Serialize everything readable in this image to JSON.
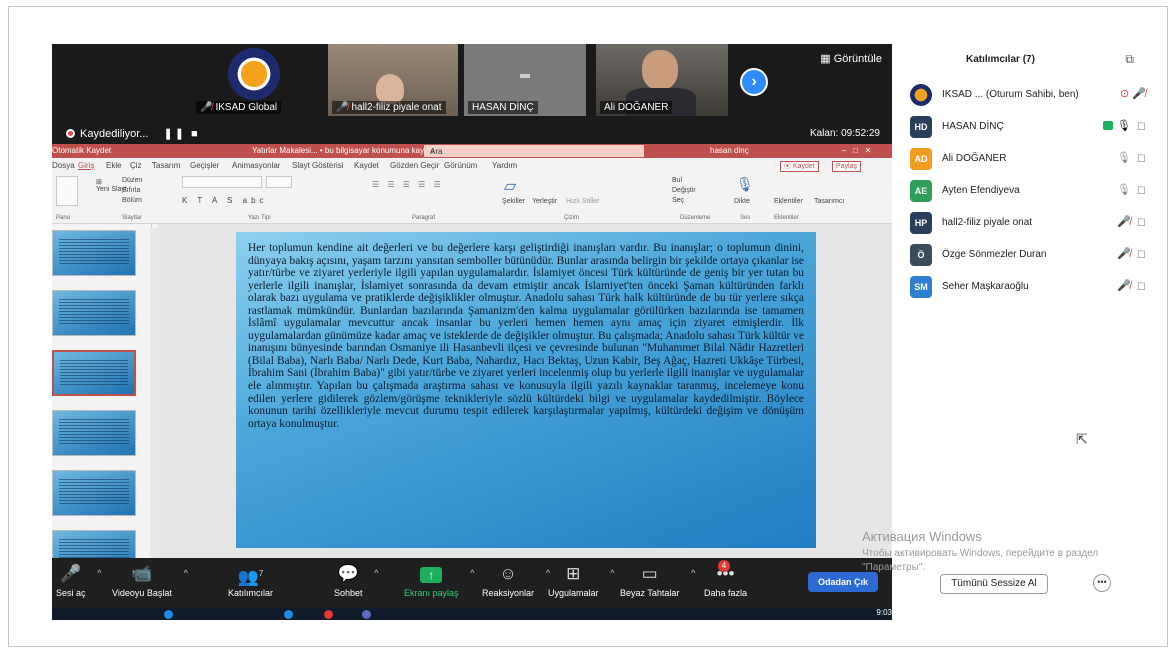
{
  "top_strip": {
    "tiles": [
      {
        "name": "IKSAD Global",
        "muted": true
      },
      {
        "name": "hall2-filiz piyale onat",
        "muted": true
      },
      {
        "name": "HASAN DİNÇ",
        "muted": false
      },
      {
        "name": "Ali DOĞANER",
        "muted": false
      }
    ],
    "view_label": "Görüntüle"
  },
  "recording": {
    "label": "Kaydediliyor...",
    "controls": "❚❚ ■",
    "remaining": "Kalan: 09:52:29"
  },
  "ppt": {
    "title_left": "Otomatik Kaydet",
    "title_center": "Yatırlar Makalesi... • bu bilgisayar konumuna kaydedildi ˅",
    "search_placeholder": "Ara",
    "user": "hasan dinç",
    "tabs": [
      "Dosya",
      "Giriş",
      "Ekle",
      "Çiz",
      "Tasarım",
      "Geçişler",
      "Animasyonlar",
      "Slayt Gösterisi",
      "Kaydet",
      "Gözden Geçir",
      "Görünüm",
      "Yardım"
    ],
    "record_btn": "⦿ Kaydet",
    "share_btn": "Paylaş",
    "groups": [
      "Pano",
      "Slaytlar",
      "Yazı Tipi",
      "Paragraf",
      "Çizim",
      "Düzenleme",
      "Ses",
      "Eklentiler"
    ],
    "ribbon_items": {
      "new_slide": "Yeni Slayt",
      "layout": "Düzen",
      "reset": "Sıfırla",
      "section": "Bölüm",
      "shapes": "Şekiller",
      "arrange": "Yerleştir",
      "quick_styles": "Hızlı Stiller",
      "find": "Bul",
      "replace": "Değiştir",
      "select": "Seç",
      "dictate": "Dikte",
      "addins": "Eklentiler",
      "designer": "Tasarımcı"
    }
  },
  "slide_text": "Her toplumun kendine ait değerleri ve bu değerlere karşı geliştirdiği inanışları vardır. Bu inanışlar; o toplumun dinini, dünyaya bakış açısını, yaşam tarzını yansıtan semboller bütünüdür. Bunlar arasında belirgin bir şekilde ortaya çıkanlar ise yatır/türbe ve ziyaret yerleriyle ilgili yapılan uygulamalardır. İslamiyet öncesi Türk kültüründe de geniş bir yer tutan bu yerlerle ilgili inanışlar, İslamiyet sonrasında da devam etmiştir ancak İslamiyet'ten önceki Şaman kültüründen farklı olarak bazı uygulama ve pratiklerde değişiklikler olmuştur. Anadolu sahası Türk halk kültüründe de bu tür yerlere sıkça rastlamak mümkündür. Bunlardan bazılarında Şamanizm'den kalma uygulamalar görülürken bazılarında ise tamamen İslâmî uygulamalar mevcuttur ancak insanlar bu yerleri hemen hemen aynı amaç için ziyaret etmişlerdir. İlk uygulamalardan günümüze kadar amaç ve isteklerde de değişikler olmuştur. Bu çalışmada; Anadolu sahası Türk kültür ve inanışını bünyesinde barından Osmaniye ili Hasanbevli ilçesi ve çevresinde bulunan \"Muhammet Bilal Nâdir Hazretleri (Bilal Baba), Narlı Baba/ Narlı Dede, Kurt Baba, Nahardız, Hacı Bektaş, Uzun Kabir, Beş Ağaç, Hazreti Ukkâşe Türbesi, İbrahim Sani (İbrahim Baba)\" gibi yatır/türbe ve ziyaret yerleri incelenmiş olup bu yerlerle ilgili inanışlar ve uygulamalar ele alınmıştır. Yapılan bu çalışmada araştırma sahası ve konusuyla ilgili yazılı kaynaklar taranmış, incelemeye konu edilen yerlere gidilerek gözlem/görüşme teknikleriyle sözlü kültürdeki bilgi ve uygulamalar kaydedilmiştir. Böylece konunun tarihi özellikleriyle mevcut durumu tespit edilerek karşılaştırmalar yapılmış, kültürdeki değişim ve dönüşüm ortaya konulmuştur.",
  "toolbar": {
    "items": [
      {
        "label": "Sesi aç",
        "icon": "🎤"
      },
      {
        "label": "Videoyu Başlat",
        "icon": "📹"
      },
      {
        "label": "Katılımcılar",
        "icon": "👥",
        "count": "7"
      },
      {
        "label": "Sohbet",
        "icon": "💬"
      },
      {
        "label": "Ekranı paylaş",
        "icon": "↑"
      },
      {
        "label": "Reaksiyonlar",
        "icon": "☺"
      },
      {
        "label": "Uygulamalar",
        "icon": "⊞"
      },
      {
        "label": "Beyaz Tahtalar",
        "icon": "▭"
      },
      {
        "label": "Daha fazla",
        "icon": "•••",
        "badge": "4"
      }
    ],
    "leave": "Odadan Çık",
    "taskbar_time": "9:03"
  },
  "participants": {
    "title": "Katılımcılar (7)",
    "list": [
      {
        "initials": "",
        "name": "IKSAD ... (Oturum Sahibi, ben)",
        "color": "#f1a31c",
        "mic": "muted"
      },
      {
        "initials": "HD",
        "name": "HASAN DİNÇ",
        "color": "#2b3d5c",
        "mic": "on"
      },
      {
        "initials": "AD",
        "name": "Ali DOĞANER",
        "color": "#f29d1f",
        "mic": "off"
      },
      {
        "initials": "AE",
        "name": "Ayten Efendiyeva",
        "color": "#2e9e5b",
        "mic": "off"
      },
      {
        "initials": "HP",
        "name": "hall2-filiz piyale onat",
        "color": "#2b3d5c",
        "mic": "muted"
      },
      {
        "initials": "Ö",
        "name": "Özge Sönmezler Duran",
        "color": "#3a4b5c",
        "mic": "muted"
      },
      {
        "initials": "SM",
        "name": "Seher Maşkaraoğlu",
        "color": "#2f7fd1",
        "mic": "muted"
      }
    ],
    "mute_all": "Tümünü Sessize Al",
    "more": "•••"
  },
  "watermark": {
    "line1": "Активация Windows",
    "line2": "Чтобы активировать Windows, перейдите в раздел \"Параметры\"."
  }
}
